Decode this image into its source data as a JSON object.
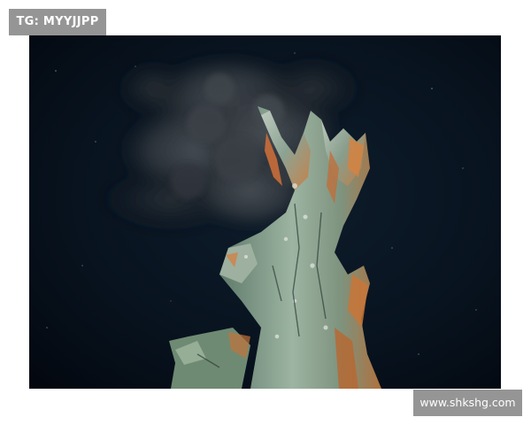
{
  "watermarks": {
    "top_left": "TG: MYYJJPP",
    "bottom_right": "www.shkshg.com"
  },
  "photo": {
    "subject": "hydrothermal-vent-chimney",
    "colors": {
      "background": "#07111d",
      "smoke": "#3a4046",
      "chimney_green": "#7f9a86",
      "chimney_orange": "#c4743b"
    }
  }
}
